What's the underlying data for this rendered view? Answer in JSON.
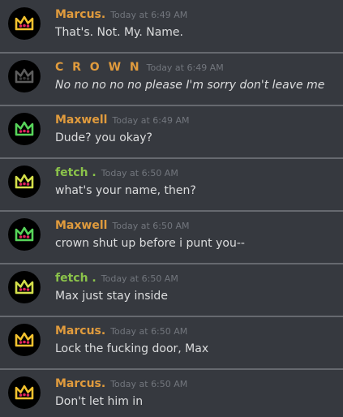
{
  "colors": {
    "background": "#36393f",
    "divider": "#8e9297",
    "timestamp": "#72767d",
    "text": "#dcddde"
  },
  "messages": [
    {
      "author": "Marcus.",
      "author_color": "#e09b3d",
      "timestamp": "Today at 6:49 AM",
      "text": "That's. Not. My. Name.",
      "italic": false,
      "avatar": {
        "icon": "crown-icon",
        "color": "#f2c12e",
        "eyes": "#e0245e"
      }
    },
    {
      "author": "C R O W N",
      "author_color": "#e09b3d",
      "timestamp": "Today at 6:49 AM",
      "text": "No no no no no please I'm sorry don't leave me",
      "italic": true,
      "avatar": {
        "icon": "crown-icon",
        "color": "#5d5d5d",
        "eyes": "#3a3a3a"
      }
    },
    {
      "author": "Maxwell",
      "author_color": "#e09b3d",
      "timestamp": "Today at 6:49 AM",
      "text": "Dude? you okay?",
      "italic": false,
      "avatar": {
        "icon": "crown-icon",
        "color": "#57d45a",
        "eyes": "#e0245e"
      }
    },
    {
      "author": "fetch .",
      "author_color": "#8bc34a",
      "timestamp": "Today at 6:50 AM",
      "text": "what's your name, then?",
      "italic": false,
      "avatar": {
        "icon": "crown-icon",
        "color": "#d4df4a",
        "eyes": "#e0245e"
      }
    },
    {
      "author": "Maxwell",
      "author_color": "#e09b3d",
      "timestamp": "Today at 6:50 AM",
      "text": "crown shut up before i punt you--",
      "italic": false,
      "avatar": {
        "icon": "crown-icon",
        "color": "#57d45a",
        "eyes": "#e0245e"
      }
    },
    {
      "author": "fetch .",
      "author_color": "#8bc34a",
      "timestamp": "Today at 6:50 AM",
      "text": "Max just stay inside",
      "italic": false,
      "avatar": {
        "icon": "crown-icon",
        "color": "#d4df4a",
        "eyes": "#e0245e"
      }
    },
    {
      "author": "Marcus.",
      "author_color": "#e09b3d",
      "timestamp": "Today at 6:50 AM",
      "text": "Lock the fucking door, Max",
      "italic": false,
      "avatar": {
        "icon": "crown-icon",
        "color": "#f2c12e",
        "eyes": "#e0245e"
      }
    },
    {
      "author": "Marcus.",
      "author_color": "#e09b3d",
      "timestamp": "Today at 6:50 AM",
      "text": "Don't let him in",
      "italic": false,
      "avatar": {
        "icon": "crown-icon",
        "color": "#f2c12e",
        "eyes": "#e0245e"
      }
    }
  ]
}
